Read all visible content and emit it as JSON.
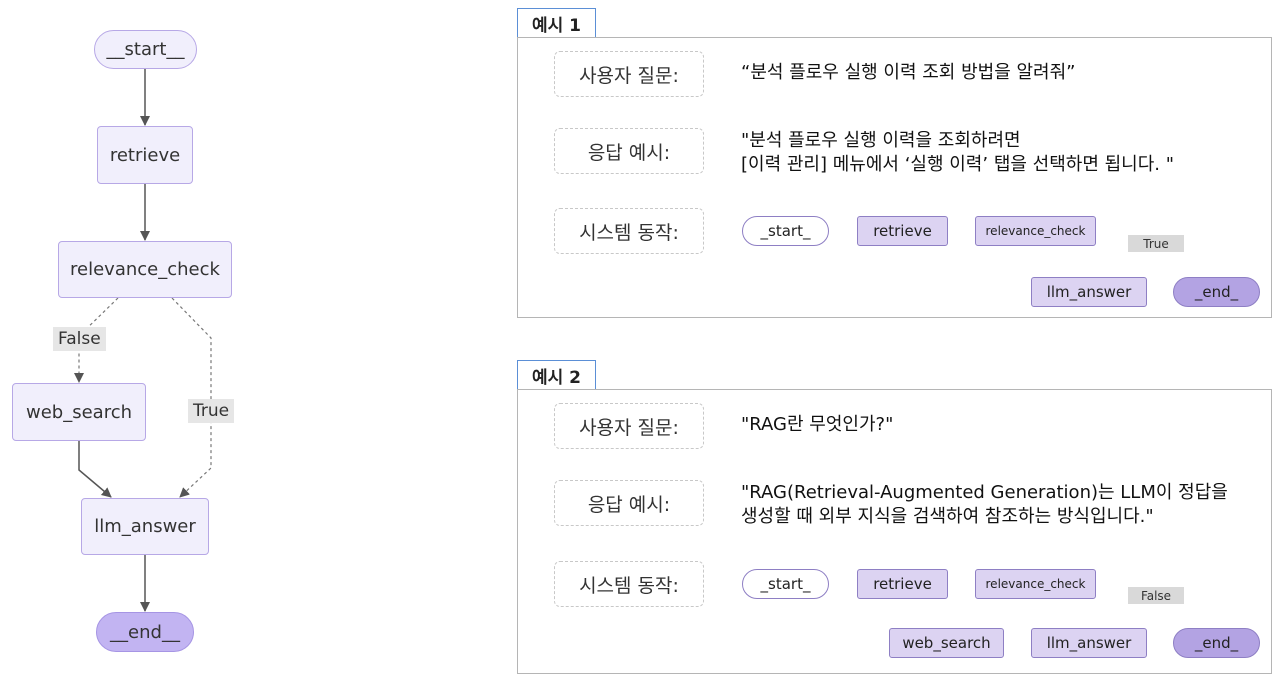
{
  "left_graph": {
    "nodes": {
      "start": "__start__",
      "retrieve": "retrieve",
      "relevance_check": "relevance_check",
      "web_search": "web_search",
      "llm_answer": "llm_answer",
      "end": "__end__"
    },
    "edge_labels": {
      "false": "False",
      "true": "True"
    }
  },
  "examples": [
    {
      "tab": "예시 1",
      "question_label": "사용자 질문:",
      "question": "“분석 플로우 실행 이력 조회 방법을 알려줘”",
      "answer_label": "응답 예시:",
      "answer_line1": "\"분석 플로우 실행 이력을 조회하려면",
      "answer_line2": "[이력 관리] 메뉴에서 ‘실행 이력’ 탭을 선택하면 됩니다. \"",
      "action_label": "시스템 동작:",
      "flow": {
        "start": "_start_",
        "retrieve": "retrieve",
        "relevance_check": "relevance_check",
        "branch": "True",
        "llm_answer": "llm_answer",
        "end": "_end_"
      }
    },
    {
      "tab": "예시 2",
      "question_label": "사용자 질문:",
      "question": "\"RAG란 무엇인가?\"",
      "answer_label": "응답 예시:",
      "answer_line1": "\"RAG(Retrieval-Augmented Generation)는 LLM이 정답을",
      "answer_line2": "생성할 때 외부 지식을 검색하여 참조하는 방식입니다.\"",
      "action_label": "시스템 동작:",
      "flow": {
        "start": "_start_",
        "retrieve": "retrieve",
        "relevance_check": "relevance_check",
        "branch": "False",
        "web_search": "web_search",
        "llm_answer": "llm_answer",
        "end": "_end_"
      }
    }
  ]
}
